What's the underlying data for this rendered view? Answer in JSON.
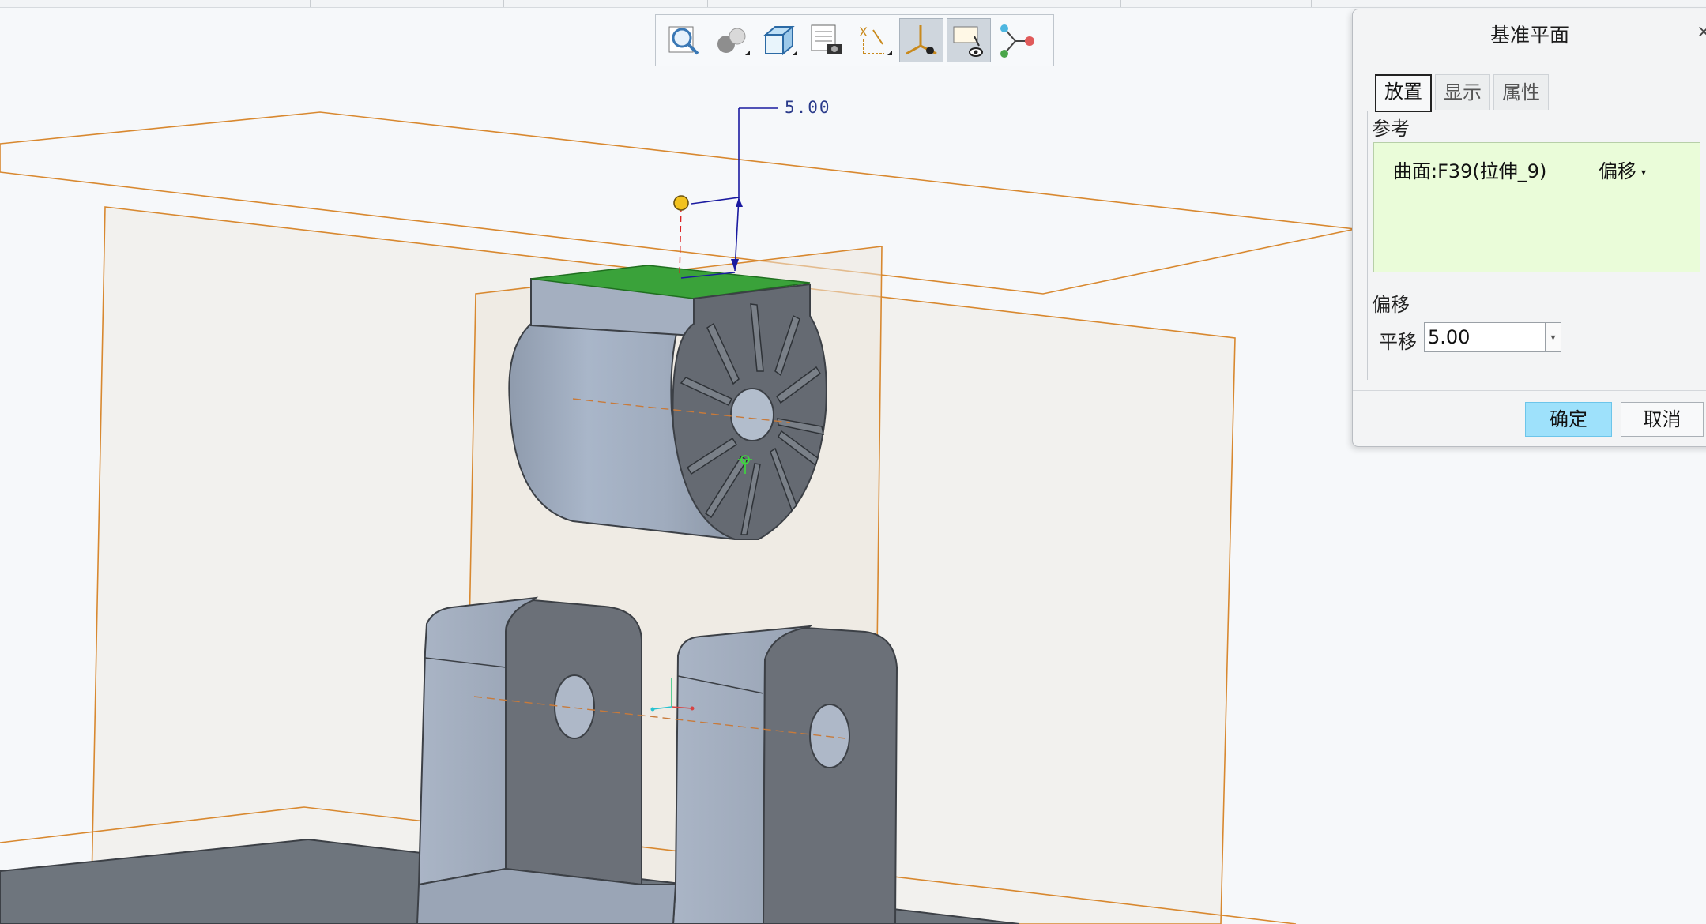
{
  "toolbar": {
    "items": [
      {
        "name": "refit-view",
        "icon": "magnifier-icon",
        "active": false
      },
      {
        "name": "appearance",
        "icon": "spheres-icon",
        "active": false
      },
      {
        "name": "display-style",
        "icon": "cube-icon",
        "active": false
      },
      {
        "name": "saved-views",
        "icon": "view-camera-icon",
        "active": false
      },
      {
        "name": "annotation-display",
        "icon": "annotation-icon",
        "active": false
      },
      {
        "name": "datum-display",
        "icon": "datum-axes-icon",
        "active": true
      },
      {
        "name": "view-manager",
        "icon": "view-manager-icon",
        "active": true
      },
      {
        "name": "spin-center",
        "icon": "network-icon",
        "active": false
      }
    ]
  },
  "model": {
    "dimension_text": "5.00"
  },
  "dialog": {
    "title": "基准平面",
    "close_glyph": "×",
    "tabs": [
      "放置",
      "显示",
      "属性"
    ],
    "active_tab": "放置",
    "references_label": "参考",
    "reference_item": "曲面:F39(拉伸_9)",
    "reference_constraint": "偏移",
    "dropdown_glyph": "▾",
    "offset_section_label": "偏移",
    "translation_label": "平移",
    "translation_value": "5.00",
    "ok_label": "确定",
    "cancel_label": "取消"
  },
  "colors": {
    "selected_surface": "#3aa23a",
    "datum_plane_edge": "#d8882f",
    "dimension_line": "#1a1aa0",
    "ok_button": "#9ee1fb",
    "reference_background": "#eafcd9"
  }
}
